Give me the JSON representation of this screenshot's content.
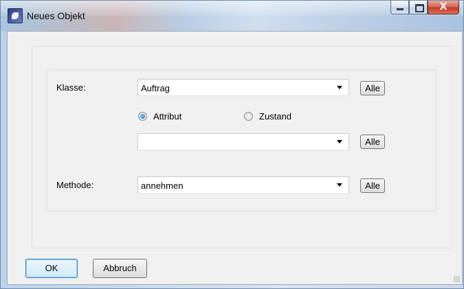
{
  "window": {
    "title": "Neues Objekt",
    "controls": {
      "minimize": "minimize",
      "maximize": "maximize",
      "close": "X"
    }
  },
  "form": {
    "klasse_label": "Klasse:",
    "klasse_value": "Auftrag",
    "klasse_alle": "Alle",
    "radio_attribut": "Attribut",
    "radio_zustand": "Zustand",
    "selected_radio": "Attribut",
    "attribut_value": "",
    "attribut_alle": "Alle",
    "methode_label": "Methode:",
    "methode_value": "annehmen",
    "methode_alle": "Alle"
  },
  "footer": {
    "ok_label": "OK",
    "abbruch_label": "Abbruch"
  }
}
